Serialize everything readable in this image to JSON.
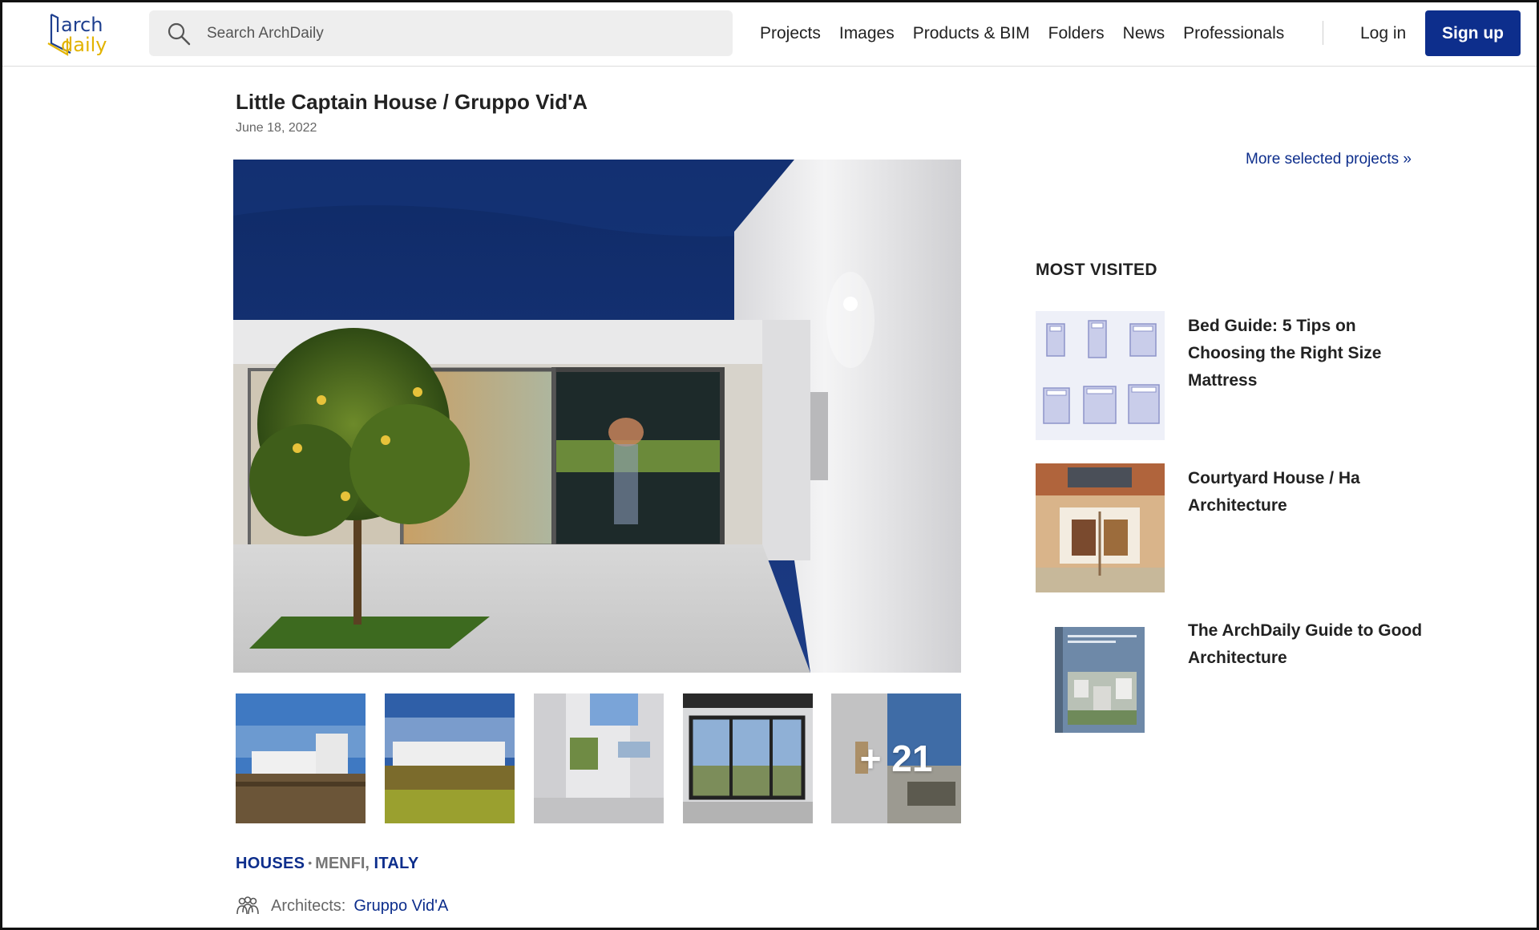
{
  "header": {
    "logo": {
      "line1": "arch",
      "line2": "daily"
    },
    "search": {
      "placeholder": "Search ArchDaily",
      "value": ""
    },
    "nav": [
      {
        "label": "Projects"
      },
      {
        "label": "Images"
      },
      {
        "label": "Products & BIM"
      },
      {
        "label": "Folders"
      },
      {
        "label": "News"
      },
      {
        "label": "Professionals"
      }
    ],
    "login_label": "Log in",
    "signup_label": "Sign up"
  },
  "article": {
    "title": "Little Captain House / Gruppo Vid'A",
    "date": "June 18, 2022",
    "thumbnails": {
      "more_label": "+ 21"
    },
    "category": "HOUSES",
    "separator": "•",
    "city": "MENFI,",
    "country": "ITALY",
    "architects_label": "Architects:",
    "architects_value": "Gruppo Vid'A"
  },
  "sidebar": {
    "more_selected": "More selected projects »",
    "most_visited_heading": "MOST VISITED",
    "items": [
      {
        "title": "Bed Guide: 5 Tips on Choosing the Right Size Mattress"
      },
      {
        "title": "Courtyard House / Ha Architecture"
      },
      {
        "title": "The ArchDaily Guide to Good Architecture"
      }
    ]
  },
  "colors": {
    "brand_blue": "#0d2e8c",
    "logo_yellow": "#e2b300",
    "link_blue": "#0d2e8c"
  }
}
